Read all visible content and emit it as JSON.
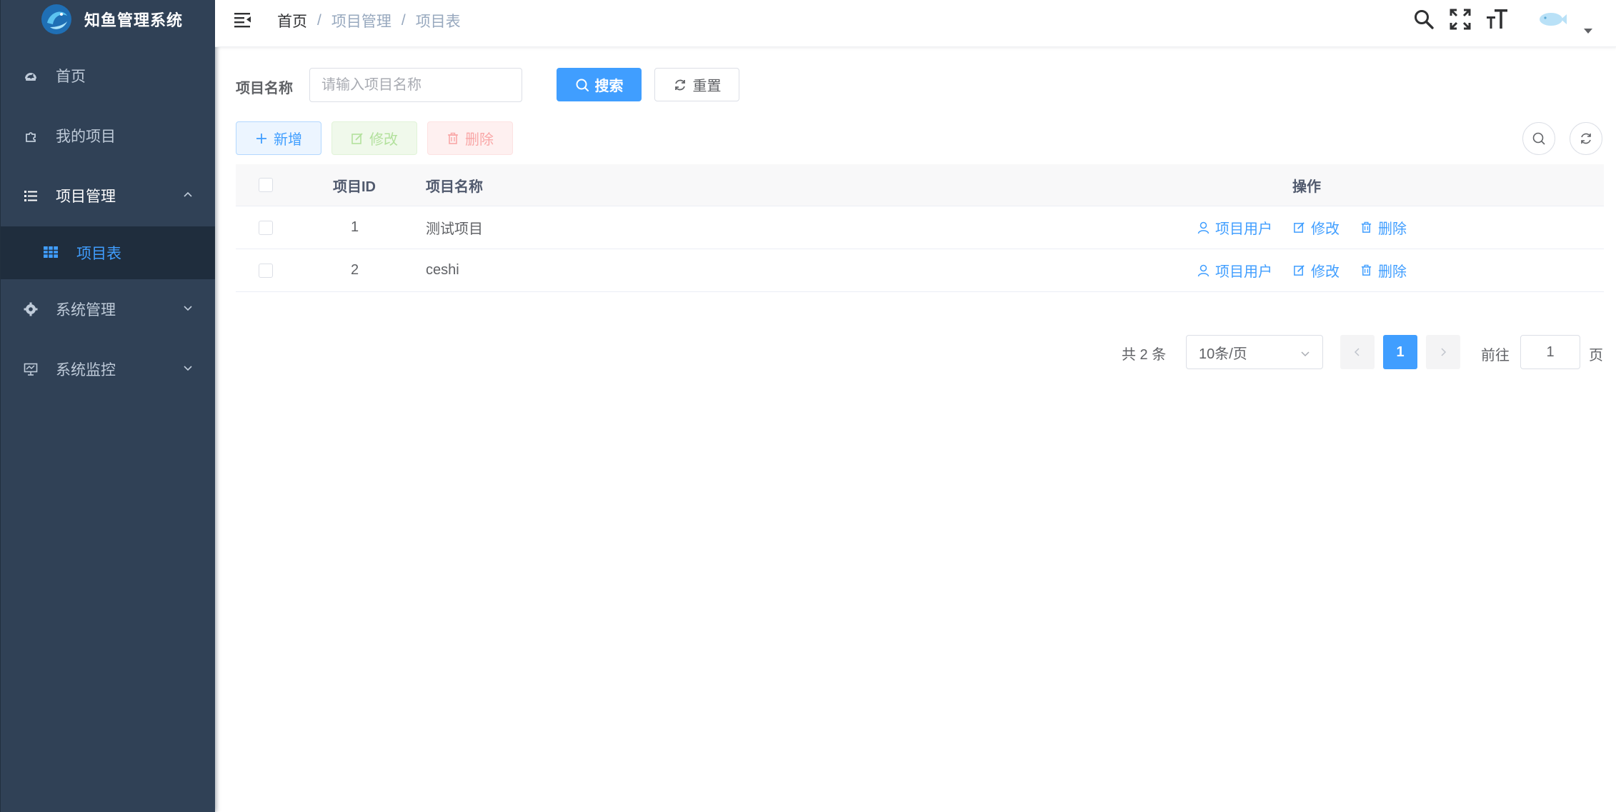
{
  "app": {
    "title": "知鱼管理系统",
    "colors": {
      "sidebar_bg": "#304156",
      "primary": "#409eff",
      "menu_text": "#bfcbd9"
    }
  },
  "sidebar": {
    "items": [
      {
        "label": "首页",
        "icon": "dashboard-icon"
      },
      {
        "label": "我的项目",
        "icon": "puzzle-icon"
      },
      {
        "label": "项目管理",
        "icon": "list-icon",
        "expanded": true,
        "children": [
          {
            "label": "项目表",
            "icon": "table-icon",
            "active": true
          }
        ]
      },
      {
        "label": "系统管理",
        "icon": "gear-icon",
        "expanded": false
      },
      {
        "label": "系统监控",
        "icon": "monitor-icon",
        "expanded": false
      }
    ]
  },
  "navbar": {
    "breadcrumb": [
      "首页",
      "项目管理",
      "项目表"
    ],
    "breadcrumb_sep": "/",
    "icons": [
      "search-icon",
      "fullscreen-icon",
      "font-size-icon",
      "avatar"
    ]
  },
  "search_form": {
    "name_label": "项目名称",
    "name_placeholder": "请输入项目名称",
    "search_label": "搜索",
    "reset_label": "重置"
  },
  "toolbar": {
    "add_label": "新增",
    "edit_label": "修改",
    "delete_label": "删除"
  },
  "table": {
    "columns": [
      "项目ID",
      "项目名称",
      "操作"
    ],
    "rows": [
      {
        "id": "1",
        "name": "测试项目",
        "actions": [
          "项目用户",
          "修改",
          "删除"
        ]
      },
      {
        "id": "2",
        "name": "ceshi",
        "actions": [
          "项目用户",
          "修改",
          "删除"
        ]
      }
    ]
  },
  "pagination": {
    "total_text": "共 2 条",
    "page_size": "10条/页",
    "current_page": "1",
    "goto_label": "前往",
    "goto_value": "1",
    "page_suffix": "页"
  }
}
